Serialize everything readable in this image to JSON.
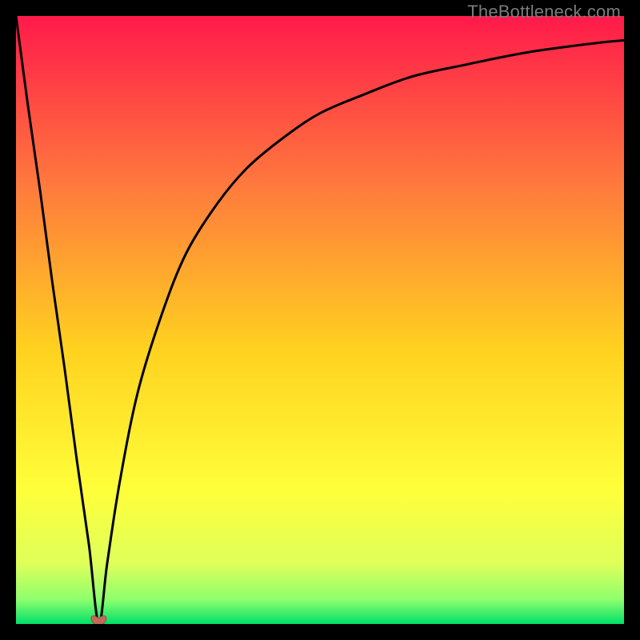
{
  "watermark": {
    "text": "TheBottleneck.com"
  },
  "colors": {
    "top": "#ff1a4a",
    "mid_upper": "#ff7a3d",
    "mid": "#ffd21f",
    "mid_lower": "#ffff3a",
    "near_bottom": "#dfff5a",
    "bottom_band_top": "#8eff6d",
    "bottom": "#00e06a",
    "curve": "#000000",
    "marker_fill": "#c46a5a",
    "marker_stroke": "#a04a3e"
  },
  "chart_data": {
    "type": "line",
    "title": "",
    "xlabel": "",
    "ylabel": "",
    "xlim": [
      0,
      100
    ],
    "ylim": [
      0,
      100
    ],
    "series": [
      {
        "name": "bottleneck-curve",
        "x": [
          0,
          2,
          4,
          6,
          8,
          10,
          12,
          13.6,
          15,
          17,
          20,
          24,
          28,
          33,
          38,
          44,
          50,
          57,
          65,
          74,
          84,
          95,
          100
        ],
        "values": [
          100,
          85,
          71,
          56,
          42,
          27,
          13,
          0,
          10,
          23,
          38,
          51,
          61,
          69,
          75,
          80,
          84,
          87,
          90,
          92,
          94,
          95.5,
          96
        ]
      }
    ],
    "marker": {
      "x": 13.6,
      "y": 0,
      "shape": "heart"
    },
    "notes": "No axes, ticks, or legend are visible. Values are estimated from the plotted curve relative to the frame (0 = bottom/left edge, 100 = top/right edge of the colored area)."
  }
}
